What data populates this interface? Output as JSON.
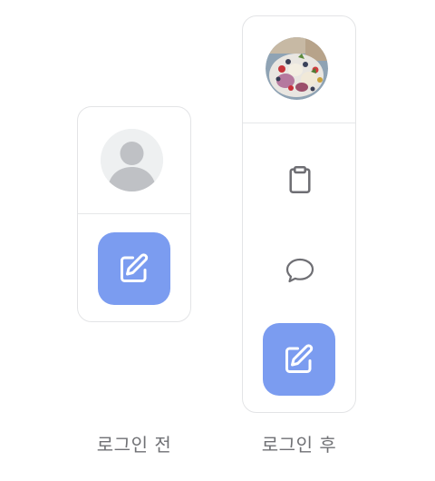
{
  "colors": {
    "accent": "#7b9cf0",
    "icon_gray": "#6e6e73",
    "avatar_placeholder_bg": "#eef0f1",
    "avatar_placeholder_fg": "#bfc1c5"
  },
  "before_login": {
    "caption": "로그인 전",
    "avatar_icon": "default-user-icon",
    "compose_icon": "edit-icon"
  },
  "after_login": {
    "caption": "로그인 후",
    "avatar_icon": "profile-photo",
    "nav_icons": [
      "clipboard-icon",
      "chat-bubble-icon"
    ],
    "compose_icon": "edit-icon"
  }
}
